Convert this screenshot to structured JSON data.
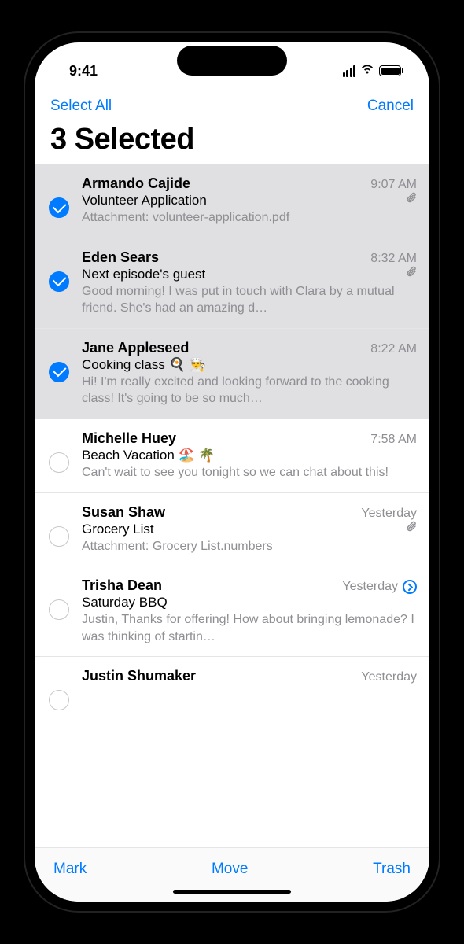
{
  "status": {
    "time": "9:41"
  },
  "nav": {
    "select_all": "Select All",
    "cancel": "Cancel"
  },
  "title": "3 Selected",
  "toolbar": {
    "mark": "Mark",
    "move": "Move",
    "trash": "Trash"
  },
  "emails": [
    {
      "sender": "Armando Cajide",
      "time": "9:07 AM",
      "subject": "Volunteer Application",
      "preview": "Attachment: volunteer-application.pdf",
      "selected": true,
      "attachment": true,
      "thread": false
    },
    {
      "sender": "Eden Sears",
      "time": "8:32 AM",
      "subject": "Next episode's guest",
      "preview": "Good morning! I was put in touch with Clara by a mutual friend. She's had an amazing d…",
      "selected": true,
      "attachment": true,
      "thread": false
    },
    {
      "sender": "Jane Appleseed",
      "time": "8:22 AM",
      "subject": "Cooking class 🍳 👨‍🍳",
      "preview": "Hi! I'm really excited and looking forward to the cooking class! It's going to be so much…",
      "selected": true,
      "attachment": false,
      "thread": false
    },
    {
      "sender": "Michelle Huey",
      "time": "7:58 AM",
      "subject": "Beach Vacation 🏖️ 🌴",
      "preview": "Can't wait to see you tonight so we can chat about this!",
      "selected": false,
      "attachment": false,
      "thread": false
    },
    {
      "sender": "Susan Shaw",
      "time": "Yesterday",
      "subject": "Grocery List",
      "preview": "Attachment: Grocery List.numbers",
      "selected": false,
      "attachment": true,
      "thread": false
    },
    {
      "sender": "Trisha Dean",
      "time": "Yesterday",
      "subject": "Saturday BBQ",
      "preview": "Justin, Thanks for offering! How about bringing lemonade? I was thinking of startin…",
      "selected": false,
      "attachment": false,
      "thread": true
    },
    {
      "sender": "Justin Shumaker",
      "time": "Yesterday",
      "subject": "",
      "preview": "",
      "selected": false,
      "attachment": false,
      "thread": false,
      "partial": true
    }
  ]
}
